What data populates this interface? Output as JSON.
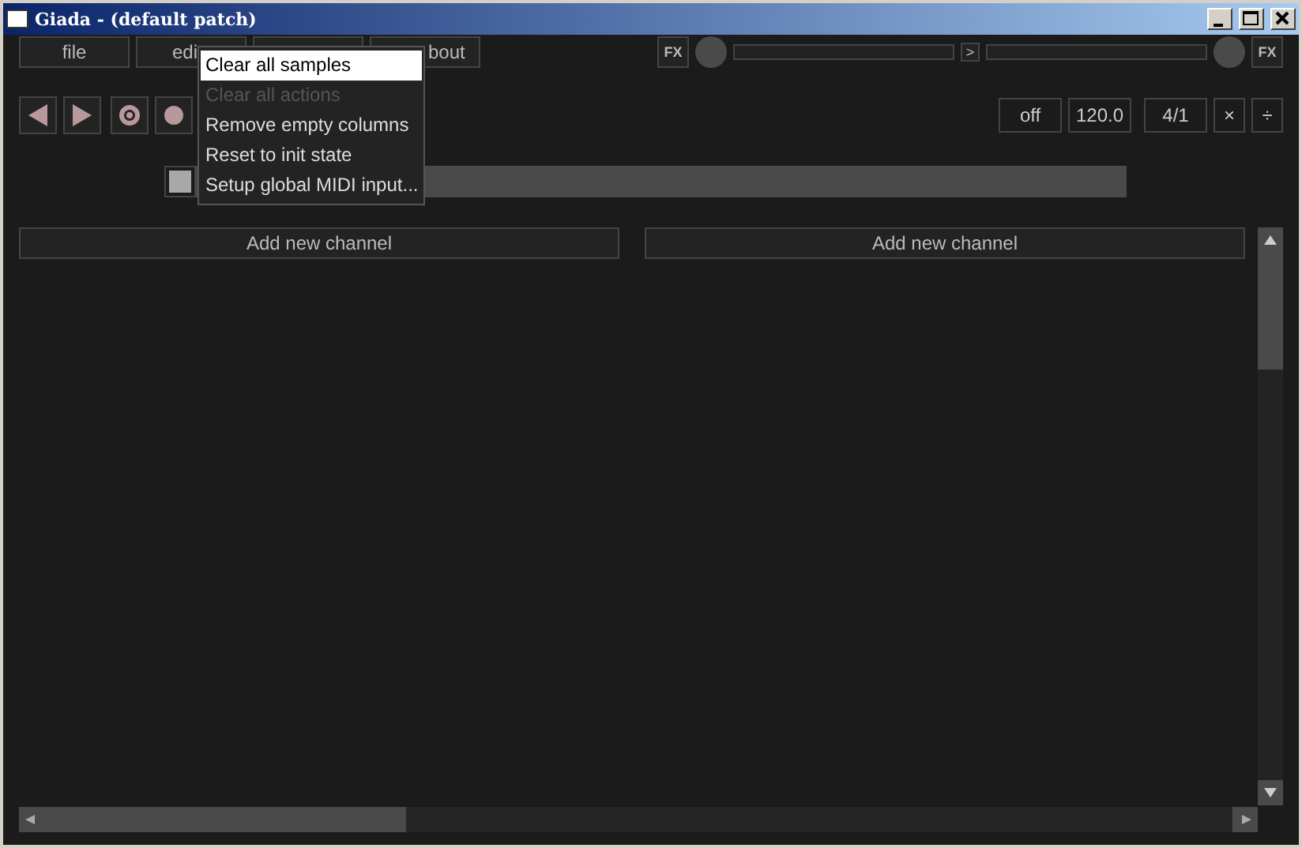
{
  "window": {
    "title": "Giada - (default patch)"
  },
  "menubar": [
    {
      "kind": "full",
      "label": "file"
    },
    {
      "kind": "left",
      "label": "edi"
    },
    {
      "kind": "covered"
    },
    {
      "kind": "right",
      "label": "bout"
    }
  ],
  "menu": [
    {
      "label": "Clear all samples",
      "selected": true,
      "disabled": false
    },
    {
      "label": "Clear all actions",
      "selected": false,
      "disabled": true
    },
    {
      "label": "Remove empty columns",
      "selected": false,
      "disabled": false
    },
    {
      "label": "Reset to init state",
      "selected": false,
      "disabled": false
    },
    {
      "label": "Setup global MIDI input...",
      "selected": false,
      "disabled": false
    }
  ],
  "io": {
    "fx_in": "FX",
    "route": ">",
    "fx_out": "FX"
  },
  "timing": {
    "quantize": "off",
    "bpm": "120.0",
    "beats": "4/1",
    "multiply": "×",
    "divide": "÷"
  },
  "columns": [
    {
      "add_label": "Add new channel"
    },
    {
      "add_label": "Add new channel"
    }
  ]
}
